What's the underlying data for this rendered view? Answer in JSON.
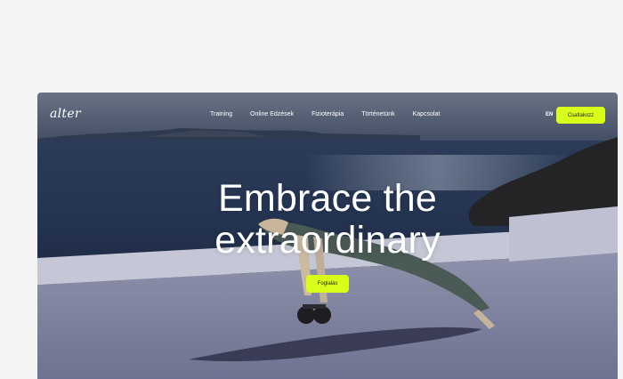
{
  "brand": {
    "logo_text": "alter"
  },
  "nav": {
    "items": [
      {
        "label": "Training"
      },
      {
        "label": "Online Edzések"
      },
      {
        "label": "Fizioterápia"
      },
      {
        "label": "Történetünk"
      },
      {
        "label": "Kapcsolat"
      }
    ],
    "lang_label": "EN",
    "cta_label": "Csatlakozz"
  },
  "hero": {
    "title_line1": "Embrace the",
    "title_line2": "extraordinary",
    "button_label": "Foglalás"
  },
  "colors": {
    "accent": "#d8ff1a",
    "page_bg": "#f4f4f4",
    "text_on_hero": "#ffffff"
  }
}
